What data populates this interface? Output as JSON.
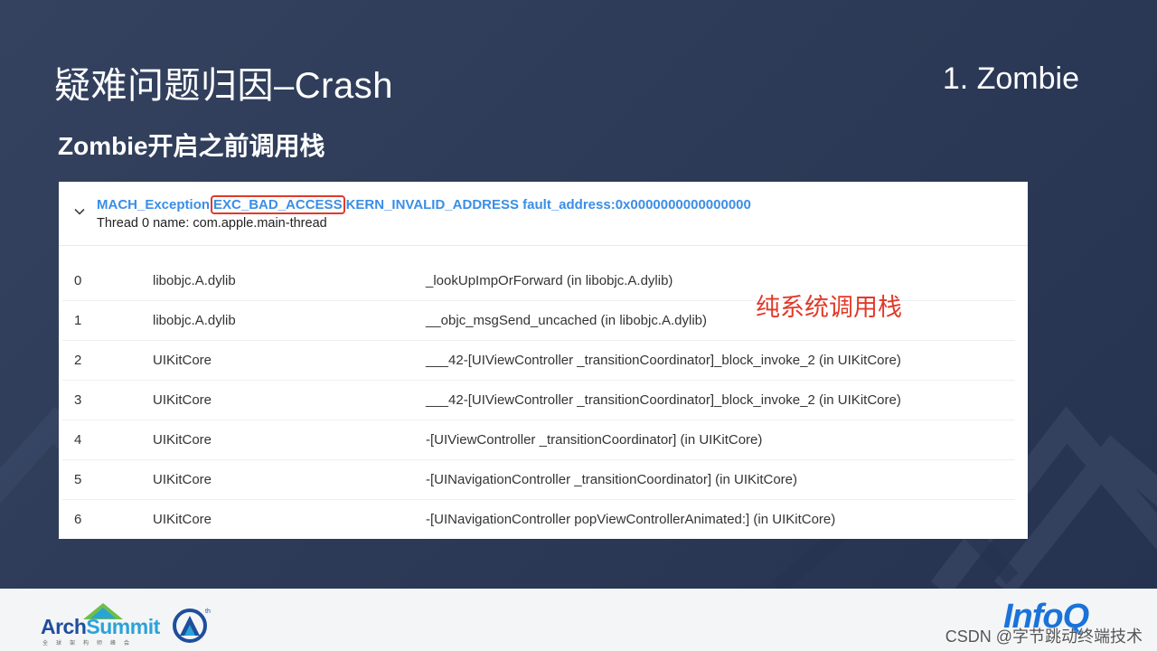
{
  "slide": {
    "title": "疑难问题归因–Crash",
    "section": "1. Zombie",
    "subtitle": "Zombie开启之前调用栈"
  },
  "crash_panel": {
    "exception_prefix": "MACH_Exception",
    "exception_type": "EXC_BAD_ACCESS",
    "exception_suffix": "KERN_INVALID_ADDRESS fault_address:0x0000000000000000",
    "thread_label": "Thread 0 name: com.apple.main-thread",
    "frames": [
      {
        "index": "0",
        "library": "libobjc.A.dylib",
        "symbol": "_lookUpImpOrForward (in libobjc.A.dylib)"
      },
      {
        "index": "1",
        "library": "libobjc.A.dylib",
        "symbol": "__objc_msgSend_uncached (in libobjc.A.dylib)"
      },
      {
        "index": "2",
        "library": "UIKitCore",
        "symbol": "___42-[UIViewController _transitionCoordinator]_block_invoke_2 (in UIKitCore)"
      },
      {
        "index": "3",
        "library": "UIKitCore",
        "symbol": "___42-[UIViewController _transitionCoordinator]_block_invoke_2 (in UIKitCore)"
      },
      {
        "index": "4",
        "library": "UIKitCore",
        "symbol": "-[UIViewController _transitionCoordinator] (in UIKitCore)"
      },
      {
        "index": "5",
        "library": "UIKitCore",
        "symbol": "-[UINavigationController _transitionCoordinator] (in UIKitCore)"
      },
      {
        "index": "6",
        "library": "UIKitCore",
        "symbol": "-[UINavigationController popViewControllerAnimated:] (in UIKitCore)"
      }
    ],
    "annotation": "纯系统调用栈"
  },
  "footer": {
    "arch_logo_part1": "Arch",
    "arch_logo_part2": "Summit",
    "arch_logo_sub": "全球架构师峰会",
    "infoq_logo": "InfoQ",
    "watermark": "CSDN @字节跳动终端技术"
  },
  "colors": {
    "background": "#2c3a56",
    "link_blue": "#3a8ee6",
    "highlight_red": "#e23a2a"
  }
}
